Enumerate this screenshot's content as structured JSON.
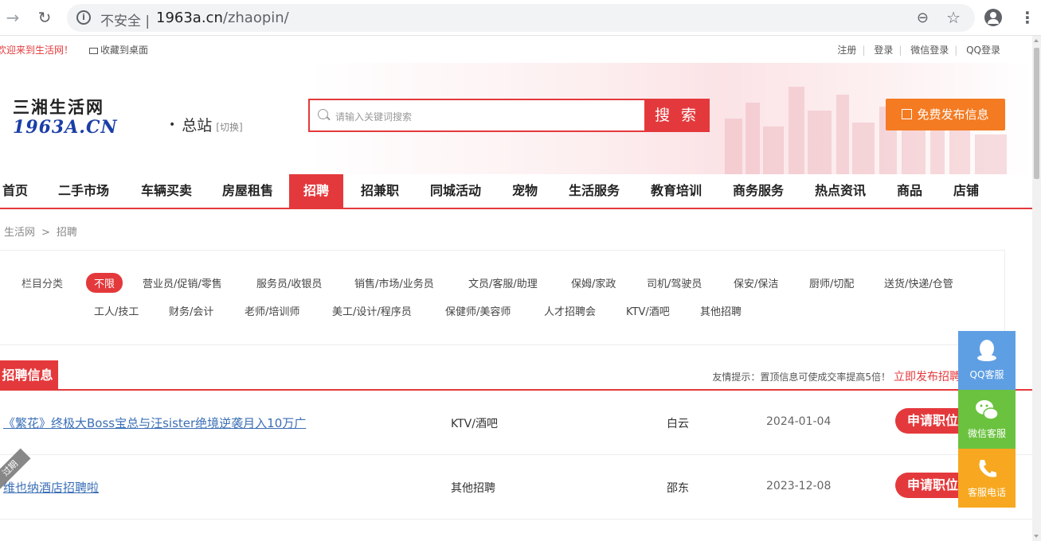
{
  "browser": {
    "insecure_label": "不安全",
    "url_host": "1963a.cn",
    "url_path": "/zhaopin/"
  },
  "topbar": {
    "welcome": "欢迎来到生活网！",
    "favorite": "收藏到桌面",
    "links": [
      "注册",
      "登录",
      "微信登录",
      "QQ登录"
    ]
  },
  "header": {
    "logo_cn": "三湘生活网",
    "logo_en": "1963A.CN",
    "station": "总站",
    "switch": "[切换]",
    "search_placeholder": "请输入关键词搜索",
    "search_button": "搜 索",
    "publish_button": "免费发布信息"
  },
  "nav": {
    "items": [
      "首页",
      "二手市场",
      "车辆买卖",
      "房屋租售",
      "招聘",
      "招兼职",
      "同城活动",
      "宠物",
      "生活服务",
      "教育培训",
      "商务服务",
      "热点资讯",
      "商品",
      "店铺"
    ],
    "active_index": 4
  },
  "breadcrumb": {
    "home": "生活网",
    "arrow": ">",
    "current": "招聘"
  },
  "filter": {
    "label": "栏目分类",
    "selected": "不限",
    "row1": [
      "营业员/促销/零售",
      "服务员/收银员",
      "销售/市场/业务员",
      "文员/客服/助理",
      "保姆/家政",
      "司机/驾驶员",
      "保安/保洁",
      "厨师/切配",
      "送货/快递/仓管"
    ],
    "row2": [
      "工人/技工",
      "财务/会计",
      "老师/培训师",
      "美工/设计/程序员",
      "保健师/美容师",
      "人才招聘会",
      "KTV/酒吧",
      "其他招聘"
    ]
  },
  "section": {
    "title": "招聘信息",
    "tip": "友情提示：置顶信息可使成交率提高5倍！",
    "tip_link": "立即发布招聘"
  },
  "listings": [
    {
      "title": "《繁花》终极大Boss宝总与汪sister绝境逆袭月入10万广",
      "category": "KTV/酒吧",
      "area": "白云",
      "date": "2024-01-04",
      "apply": "申请职位",
      "expired": ""
    },
    {
      "title": "维也纳酒店招聘啦",
      "category": "其他招聘",
      "area": "邵东",
      "date": "2023-12-08",
      "apply": "申请职位",
      "expired": "过期"
    }
  ],
  "float_service": {
    "qq": "QQ客服",
    "wechat": "微信客服",
    "phone": "客服电话"
  }
}
